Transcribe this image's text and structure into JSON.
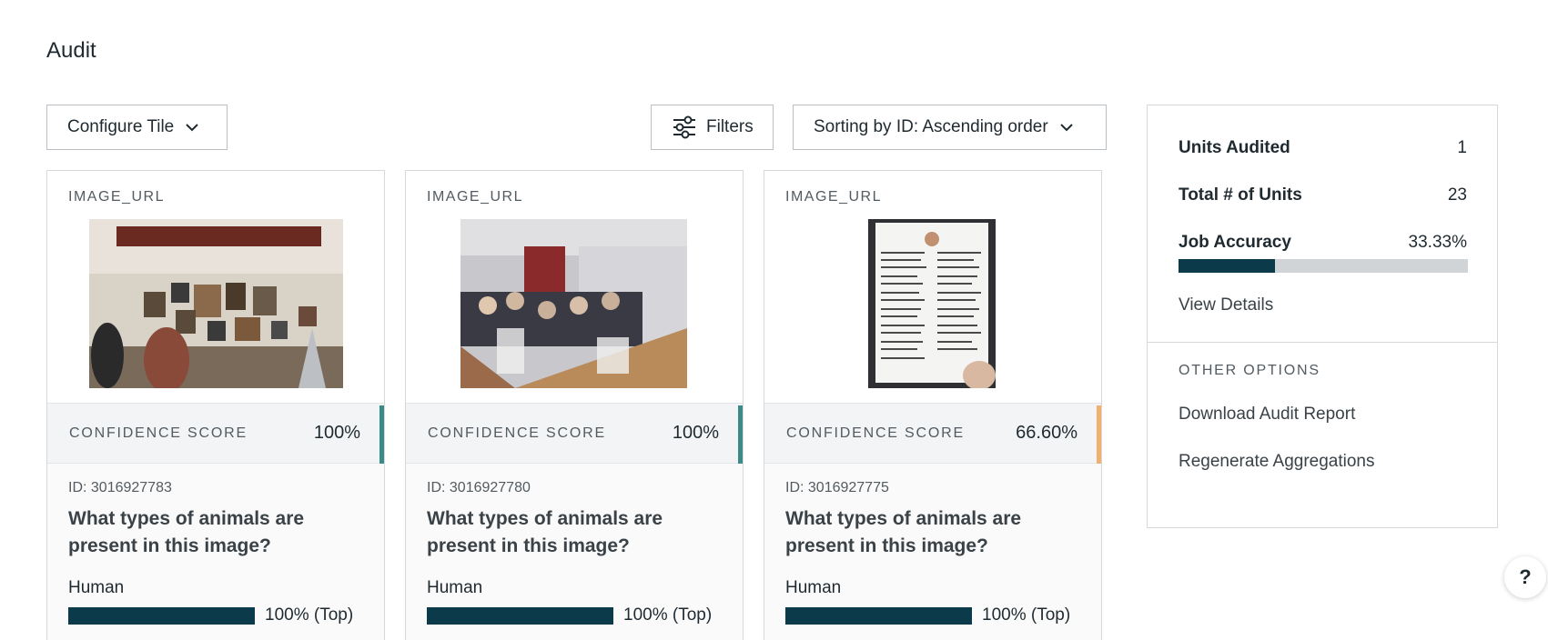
{
  "page": {
    "title": "Audit"
  },
  "toolbar": {
    "configure_label": "Configure Tile",
    "filters_label": "Filters",
    "sort_label": "Sorting by ID: Ascending order"
  },
  "cards": [
    {
      "field_label": "IMAGE_URL",
      "confidence_label": "CONFIDENCE SCORE",
      "confidence_value": "100%",
      "confidence_color": "#3a8a88",
      "unit_id": "ID: 3016927783",
      "question": "What types of animals are present in this image?",
      "answer_label": "Human",
      "answer_pct": "100% (Top)",
      "answer_fraction": 1.0
    },
    {
      "field_label": "IMAGE_URL",
      "confidence_label": "CONFIDENCE SCORE",
      "confidence_value": "100%",
      "confidence_color": "#3a8a88",
      "unit_id": "ID: 3016927780",
      "question": "What types of animals are present in this image?",
      "answer_label": "Human",
      "answer_pct": "100% (Top)",
      "answer_fraction": 1.0
    },
    {
      "field_label": "IMAGE_URL",
      "confidence_label": "CONFIDENCE SCORE",
      "confidence_value": "66.60%",
      "confidence_color": "#f0b070",
      "unit_id": "ID: 3016927775",
      "question": "What types of animals are present in this image?",
      "answer_label": "Human",
      "answer_pct": "100% (Top)",
      "answer_fraction": 1.0
    }
  ],
  "summary": {
    "units_audited_label": "Units Audited",
    "units_audited_value": "1",
    "total_units_label": "Total # of Units",
    "total_units_value": "23",
    "job_accuracy_label": "Job Accuracy",
    "job_accuracy_value": "33.33%",
    "job_accuracy_fraction": 0.3333,
    "view_details_label": "View Details",
    "other_options_label": "OTHER OPTIONS",
    "download_label": "Download Audit Report",
    "regenerate_label": "Regenerate Aggregations"
  },
  "help": {
    "label": "?"
  },
  "colors": {
    "accent_dark": "#0b3a4a",
    "confidence_high": "#3a8a88",
    "confidence_medium": "#f0b070"
  }
}
